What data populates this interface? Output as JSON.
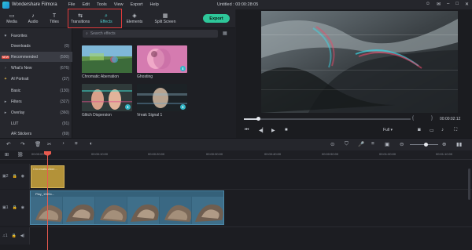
{
  "app": {
    "name": "Wondershare Filmora",
    "menu": [
      "File",
      "Edit",
      "Tools",
      "View",
      "Export",
      "Help"
    ],
    "document_title": "Untitled : 00:00:28:05"
  },
  "toolbar": {
    "tabs": [
      {
        "label": "Media",
        "icon": "folder-icon"
      },
      {
        "label": "Audio",
        "icon": "music-icon"
      },
      {
        "label": "Titles",
        "icon": "text-icon"
      },
      {
        "label": "Transitions",
        "icon": "transition-icon"
      },
      {
        "label": "Effects",
        "icon": "effects-icon"
      },
      {
        "label": "Elements",
        "icon": "elements-icon"
      },
      {
        "label": "Split Screen",
        "icon": "split-screen-icon"
      }
    ],
    "active_tab": "Effects",
    "export_label": "Export",
    "highlight_color": "#e23b3b",
    "accent_color": "#4fd3d3",
    "export_color": "#2ec79a"
  },
  "sidebar": {
    "items": [
      {
        "label": "Favorites",
        "count": ""
      },
      {
        "label": "Downloads",
        "count": "(0)"
      },
      {
        "label": "Recommended",
        "count": "(500)",
        "badge": "NEW"
      },
      {
        "label": "What's New",
        "count": "(676)"
      },
      {
        "label": "AI Portrait",
        "count": "(37)"
      },
      {
        "label": "Basic",
        "count": "(130)"
      },
      {
        "label": "Filters",
        "count": "(327)"
      },
      {
        "label": "Overlay",
        "count": "(360)"
      },
      {
        "label": "LUT",
        "count": "(91)"
      },
      {
        "label": "AR Stickers",
        "count": "(69)"
      }
    ]
  },
  "search": {
    "placeholder": "Search effects"
  },
  "effects": [
    {
      "label": "Chromatic Aberration"
    },
    {
      "label": "Ghosting"
    },
    {
      "label": "Glitch Dispersion"
    },
    {
      "label": "Vreak Signal 1"
    }
  ],
  "player": {
    "timecode": "00:00:02:12",
    "quality": "Full",
    "progress": 0.08
  },
  "timeline": {
    "ruler": [
      "00:00:00:00",
      "00:00:10:00",
      "00:00:20:00",
      "00:00:30:00",
      "00:00:40:00",
      "00:00:50:00",
      "00:01:00:00",
      "00:01:10:00",
      "00:01:20:00"
    ],
    "effect_clip_label": "Chromatic Aber...",
    "video_clip_label": "Play_1920x..."
  }
}
